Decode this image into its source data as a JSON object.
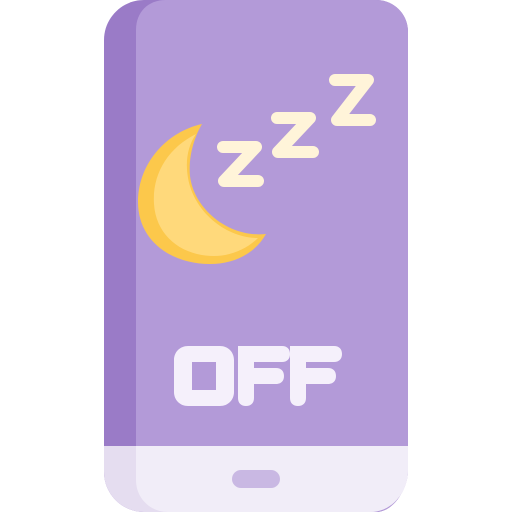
{
  "icon": {
    "name": "smartphone-sleep-mode-off-icon",
    "status_text": "OFF",
    "colors": {
      "phone_body": "#b39ad8",
      "phone_side": "#9a7bc7",
      "phone_bottom": "#f1edf8",
      "phone_bottom_side": "#e5ddf0",
      "home_button": "#c9b8e3",
      "moon": "#ffd97b",
      "moon_shadow": "#fcc84b",
      "zzz": "#fff4d9",
      "off_text": "#f5f0fb"
    },
    "parts": {
      "moon": "moon-icon",
      "sleep": "zzz-icon",
      "home": "home-button"
    }
  }
}
